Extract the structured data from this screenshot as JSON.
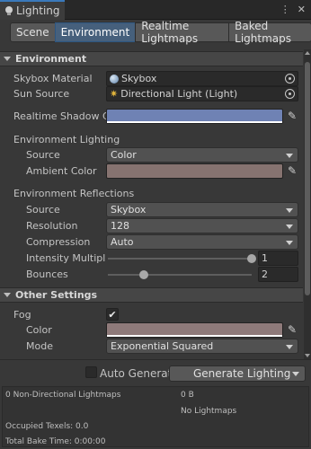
{
  "window": {
    "tab_title": "Lighting",
    "menu_icon": "kebab-menu-icon",
    "close_icon": "close-icon"
  },
  "tabs": [
    {
      "label": "Scene",
      "selected": false
    },
    {
      "label": "Environment",
      "selected": true
    },
    {
      "label": "Realtime Lightmaps",
      "selected": false
    },
    {
      "label": "Baked Lightmaps",
      "selected": false
    }
  ],
  "environment": {
    "header": "Environment",
    "skybox_material": {
      "label": "Skybox Material",
      "value": "Skybox"
    },
    "sun_source": {
      "label": "Sun Source",
      "value": "Directional Light (Light)"
    },
    "realtime_shadow_color": {
      "label": "Realtime Shadow C",
      "color": "#6f82b4"
    },
    "lighting": {
      "title": "Environment Lighting",
      "source": {
        "label": "Source",
        "value": "Color"
      },
      "ambient_color": {
        "label": "Ambient Color",
        "color": "#867370"
      }
    },
    "reflections": {
      "title": "Environment Reflections",
      "source": {
        "label": "Source",
        "value": "Skybox"
      },
      "resolution": {
        "label": "Resolution",
        "value": "128"
      },
      "compression": {
        "label": "Compression",
        "value": "Auto"
      },
      "intensity": {
        "label": "Intensity Multiplie",
        "value": "1",
        "fraction": 1.0
      },
      "bounces": {
        "label": "Bounces",
        "value": "2",
        "fraction": 0.25
      }
    }
  },
  "other": {
    "header": "Other Settings",
    "fog": {
      "label": "Fog",
      "checked": true,
      "checkmark": "✔"
    },
    "color": {
      "label": "Color",
      "color": "#8e7a7a"
    },
    "mode": {
      "label": "Mode",
      "value": "Exponential Squared"
    }
  },
  "footer": {
    "auto_generate": {
      "label": "Auto Generate",
      "checked": false
    },
    "generate_button": "Generate Lighting",
    "stats": {
      "lightmaps": "0 Non-Directional Lightmaps",
      "size": "0 B",
      "no_lightmaps": "No Lightmaps",
      "occupied": "Occupied Texels: 0.0",
      "bake_time": "Total Bake Time: 0:00:00"
    }
  },
  "colors": {
    "selected_tab": "#46607c",
    "accent": "#3a79bb"
  }
}
